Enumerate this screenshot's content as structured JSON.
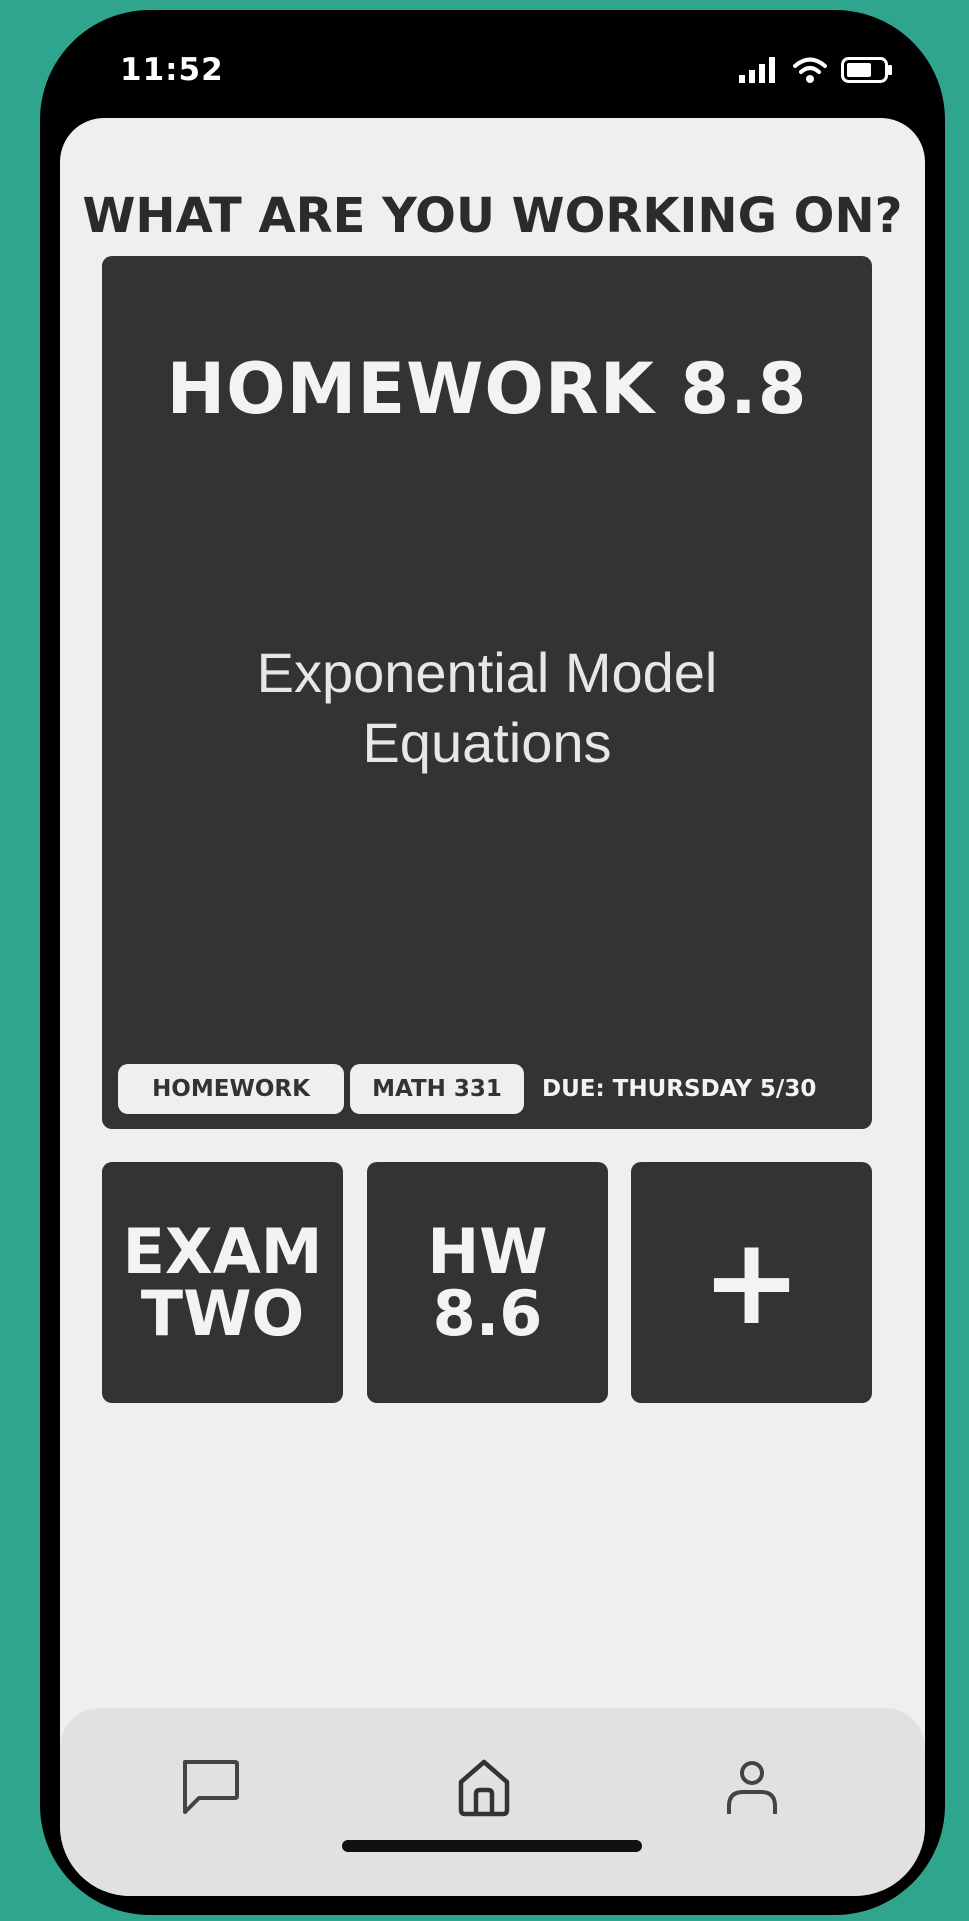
{
  "status_bar": {
    "time": "11:52",
    "icons": [
      "signal-icon",
      "wifi-icon",
      "battery-icon"
    ]
  },
  "heading": "WHAT ARE YOU WORKING ON?",
  "featured": {
    "title": "HOMEWORK 8.8",
    "subtitle": "Exponential Model Equations",
    "tags": [
      "HOMEWORK",
      "MATH 331"
    ],
    "due_label": "DUE: THURSDAY",
    "due_date": "5/30"
  },
  "tiles": [
    {
      "line1": "EXAM",
      "line2": "TWO"
    },
    {
      "line1": "HW",
      "line2": "8.6"
    },
    {
      "label": "+"
    }
  ],
  "nav": {
    "items": [
      "chat-icon",
      "home-icon",
      "profile-icon"
    ]
  },
  "colors": {
    "background": "#2ea58c",
    "screen": "#f0eeee",
    "card": "#333333",
    "nav": "#e2e0e0"
  }
}
